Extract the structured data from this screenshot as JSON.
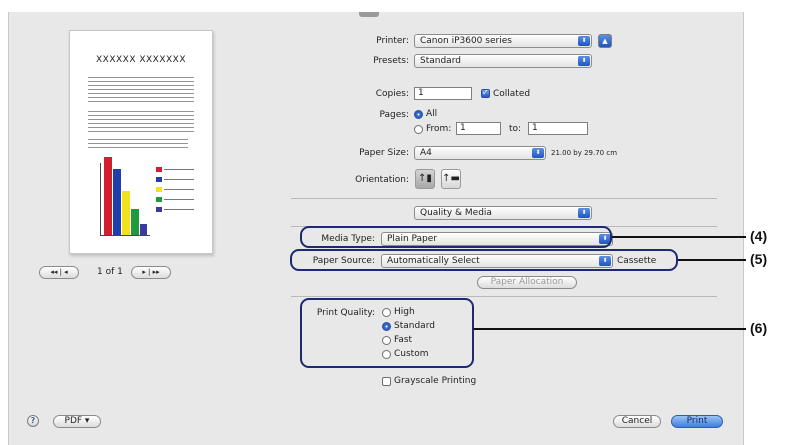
{
  "printer": {
    "label": "Printer:",
    "value": "Canon iP3600 series"
  },
  "presets": {
    "label": "Presets:",
    "value": "Standard"
  },
  "copies": {
    "label": "Copies:",
    "value": "1",
    "collated_label": "Collated",
    "collated_checked": true
  },
  "pages": {
    "label": "Pages:",
    "all_label": "All",
    "from_label": "From:",
    "from_value": "1",
    "to_label": "to:",
    "to_value": "1"
  },
  "paper_size": {
    "label": "Paper Size:",
    "value": "A4",
    "dimensions": "21.00 by 29.70 cm"
  },
  "orientation": {
    "label": "Orientation:"
  },
  "panel_menu": {
    "value": "Quality & Media"
  },
  "media_type": {
    "label": "Media Type:",
    "value": "Plain Paper"
  },
  "paper_source": {
    "label": "Paper Source:",
    "value": "Automatically Select",
    "extra": "Cassette"
  },
  "paper_allocation": {
    "label": "Paper Allocation"
  },
  "print_quality": {
    "label": "Print Quality:",
    "options": [
      "High",
      "Standard",
      "Fast",
      "Custom"
    ],
    "selected": "Standard"
  },
  "grayscale": {
    "label": "Grayscale Printing"
  },
  "preview": {
    "heading": "XXXXXX XXXXXXX",
    "page_counter": "1 of 1",
    "bar_colors": [
      "#d21f2f",
      "#1f3fa8",
      "#f2e21c",
      "#1f9a3d",
      "#3a3aa0"
    ]
  },
  "bottom": {
    "help": "?",
    "pdf": "PDF ▾",
    "cancel": "Cancel",
    "print": "Print"
  },
  "callouts": {
    "c4": "(4)",
    "c5": "(5)",
    "c6": "(6)"
  },
  "colors": {
    "highlight_border": "#1d2a73",
    "popup_arrow": "#2a5fd0"
  }
}
